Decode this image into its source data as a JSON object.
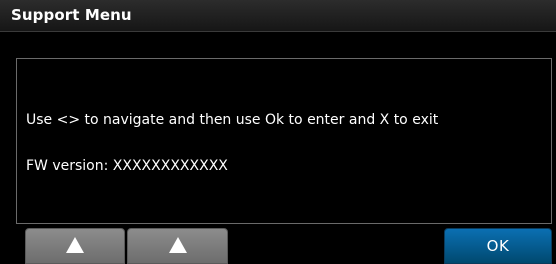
{
  "window": {
    "title": "Support Menu"
  },
  "message": {
    "line1": "Use <> to navigate and then use Ok to enter and X to exit",
    "line2": "FW version: XXXXXXXXXXXX"
  },
  "buttons": {
    "up_left_icon": "triangle-up-icon",
    "up_right_icon": "triangle-up-icon",
    "ok_label": "OK"
  },
  "colors": {
    "background": "#000000",
    "ok_button": "#0b6fb2",
    "nav_button": "#7f7f7f"
  }
}
